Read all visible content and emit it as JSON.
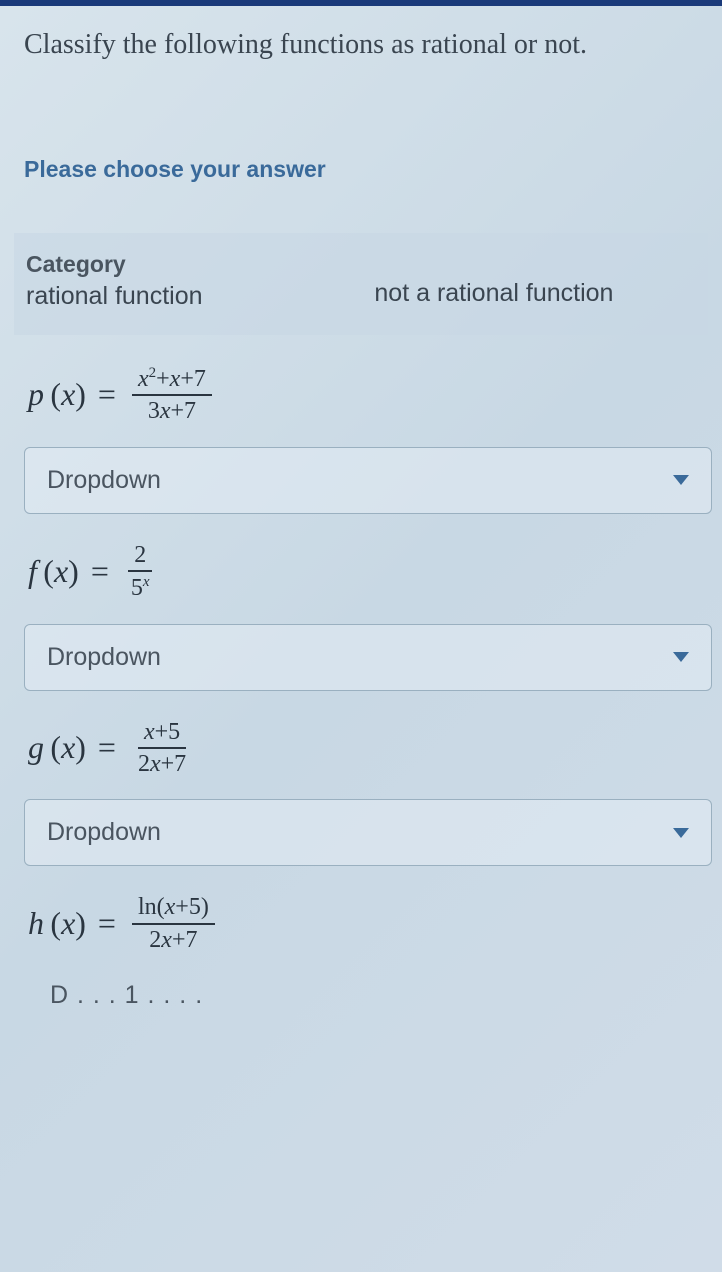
{
  "question": "Classify the following functions as rational or not.",
  "prompt": "Please choose your answer",
  "category": {
    "label": "Category",
    "rational": "rational function",
    "not_rational": "not a rational function"
  },
  "functions": [
    {
      "name": "p",
      "var": "x",
      "numerator_html": "<span class='var'>x</span><span class='sup'>2</span>+<span class='var'>x</span>+7",
      "denominator_html": "3<span class='var'>x</span>+7",
      "dropdown": "Dropdown"
    },
    {
      "name": "f",
      "var": "x",
      "numerator_html": "2",
      "denominator_html": "5<span class='supvar'>x</span>",
      "dropdown": "Dropdown"
    },
    {
      "name": "g",
      "var": "x",
      "numerator_html": "<span class='var'>x</span>+5",
      "denominator_html": "2<span class='var'>x</span>+7",
      "dropdown": "Dropdown"
    },
    {
      "name": "h",
      "var": "x",
      "numerator_html": "<span class='ln'>ln</span>(<span class='var'>x</span>+5)",
      "denominator_html": "2<span class='var'>x</span>+7",
      "dropdown": "Dropdown"
    }
  ],
  "cutoff_text": "D . . . 1 . . . ."
}
